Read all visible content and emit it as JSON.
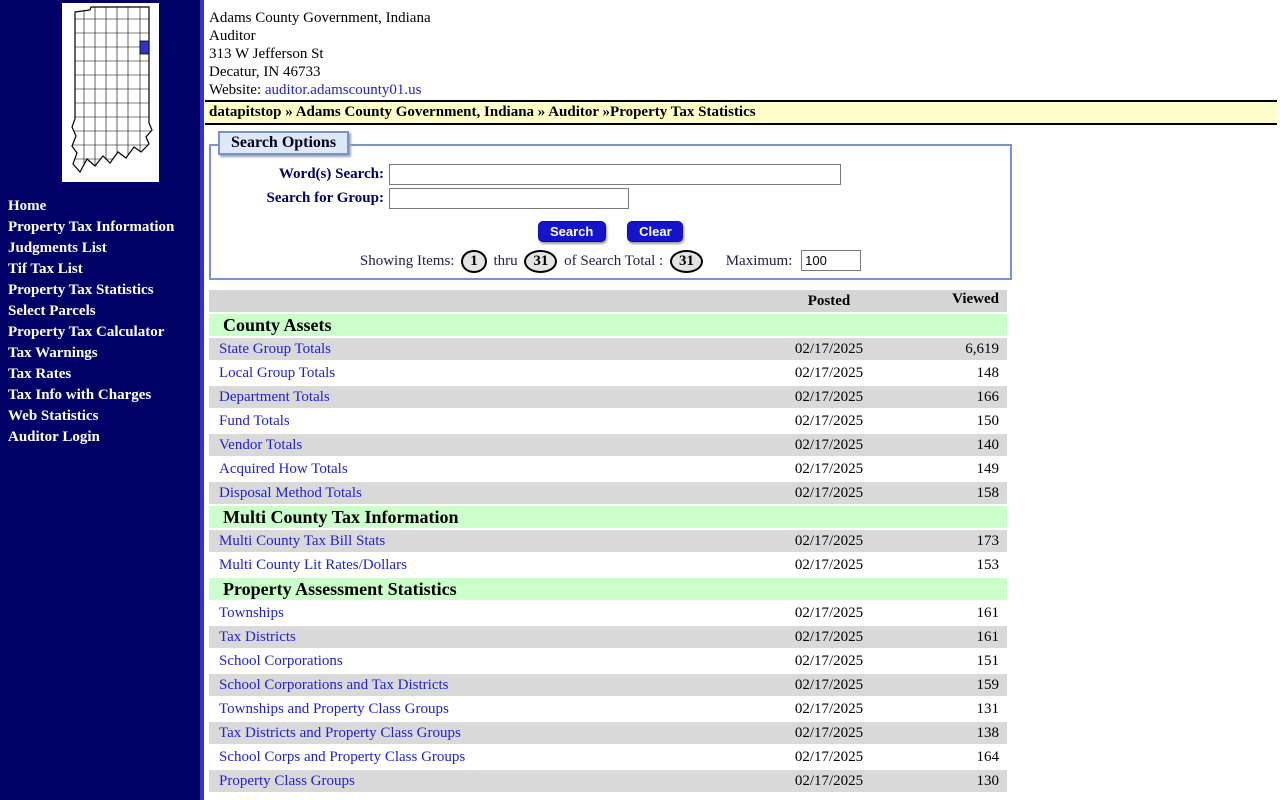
{
  "colors": {
    "sidebar_bg": "#000066",
    "divider": "#3333CC",
    "breadcrumb_bg": "#FFFFCC",
    "section_header_bg": "#CCFFCC",
    "row_gray": "#D9D9D9",
    "column_header_bg": "#D5D5D5",
    "link_blue": "#2222CC",
    "button_blue": "#1414CC",
    "highlighted_county": "#3333CC",
    "panel_border": "#7A93CC"
  },
  "header": {
    "org": "Adams County Government, Indiana",
    "dept": "Auditor",
    "address": "313 W Jefferson St",
    "city": "Decatur, IN 46733",
    "website_label": "Website:",
    "website_link": "auditor.adamscounty01.us"
  },
  "breadcrumb": {
    "text": "datapitstop » Adams County Government, Indiana » Auditor »Property Tax Statistics"
  },
  "sidebar": {
    "items": [
      "Home",
      "Property Tax Information",
      "Judgments List",
      "Tif Tax List",
      "Property Tax Statistics",
      "Select Parcels",
      "Property Tax Calculator",
      "Tax Warnings",
      "Tax Rates",
      "Tax Info with Charges",
      "Web Statistics",
      "Auditor Login"
    ]
  },
  "search": {
    "title": "Search Options",
    "word_label": "Word(s) Search:",
    "word_value": "",
    "group_label": "Search for Group:",
    "group_value": "",
    "search_button": "Search",
    "clear_button": "Clear",
    "showing_prefix": "Showing Items:",
    "from": "1",
    "thru_label": "thru",
    "to": "31",
    "total_label": "of Search Total :",
    "total": "31",
    "maximum_label": "Maximum:",
    "maximum_value": "100"
  },
  "table": {
    "posted_header": "Posted",
    "viewed_header": "Viewed",
    "sections": [
      {
        "title": "County Assets",
        "rows": [
          {
            "label": "State Group Totals",
            "posted": "02/17/2025",
            "viewed": "6,619"
          },
          {
            "label": "Local Group Totals",
            "posted": "02/17/2025",
            "viewed": "148"
          },
          {
            "label": "Department Totals",
            "posted": "02/17/2025",
            "viewed": "166"
          },
          {
            "label": "Fund Totals",
            "posted": "02/17/2025",
            "viewed": "150"
          },
          {
            "label": "Vendor Totals",
            "posted": "02/17/2025",
            "viewed": "140"
          },
          {
            "label": "Acquired How Totals",
            "posted": "02/17/2025",
            "viewed": "149"
          },
          {
            "label": "Disposal Method Totals",
            "posted": "02/17/2025",
            "viewed": "158"
          }
        ]
      },
      {
        "title": "Multi County Tax Information",
        "rows": [
          {
            "label": "Multi County Tax Bill Stats",
            "posted": "02/17/2025",
            "viewed": "173"
          },
          {
            "label": "Multi County Lit Rates/Dollars",
            "posted": "02/17/2025",
            "viewed": "153"
          }
        ]
      },
      {
        "title": "Property Assessment Statistics",
        "rows": [
          {
            "label": "Townships",
            "posted": "02/17/2025",
            "viewed": "161"
          },
          {
            "label": "Tax Districts",
            "posted": "02/17/2025",
            "viewed": "161"
          },
          {
            "label": "School Corporations",
            "posted": "02/17/2025",
            "viewed": "151"
          },
          {
            "label": "School Corporations and Tax Districts",
            "posted": "02/17/2025",
            "viewed": "159"
          },
          {
            "label": "Townships and Property Class Groups",
            "posted": "02/17/2025",
            "viewed": "131"
          },
          {
            "label": "Tax Districts and Property Class Groups",
            "posted": "02/17/2025",
            "viewed": "138"
          },
          {
            "label": "School Corps and Property Class Groups",
            "posted": "02/17/2025",
            "viewed": "164"
          },
          {
            "label": "Property Class Groups",
            "posted": "02/17/2025",
            "viewed": "130"
          }
        ]
      }
    ]
  }
}
